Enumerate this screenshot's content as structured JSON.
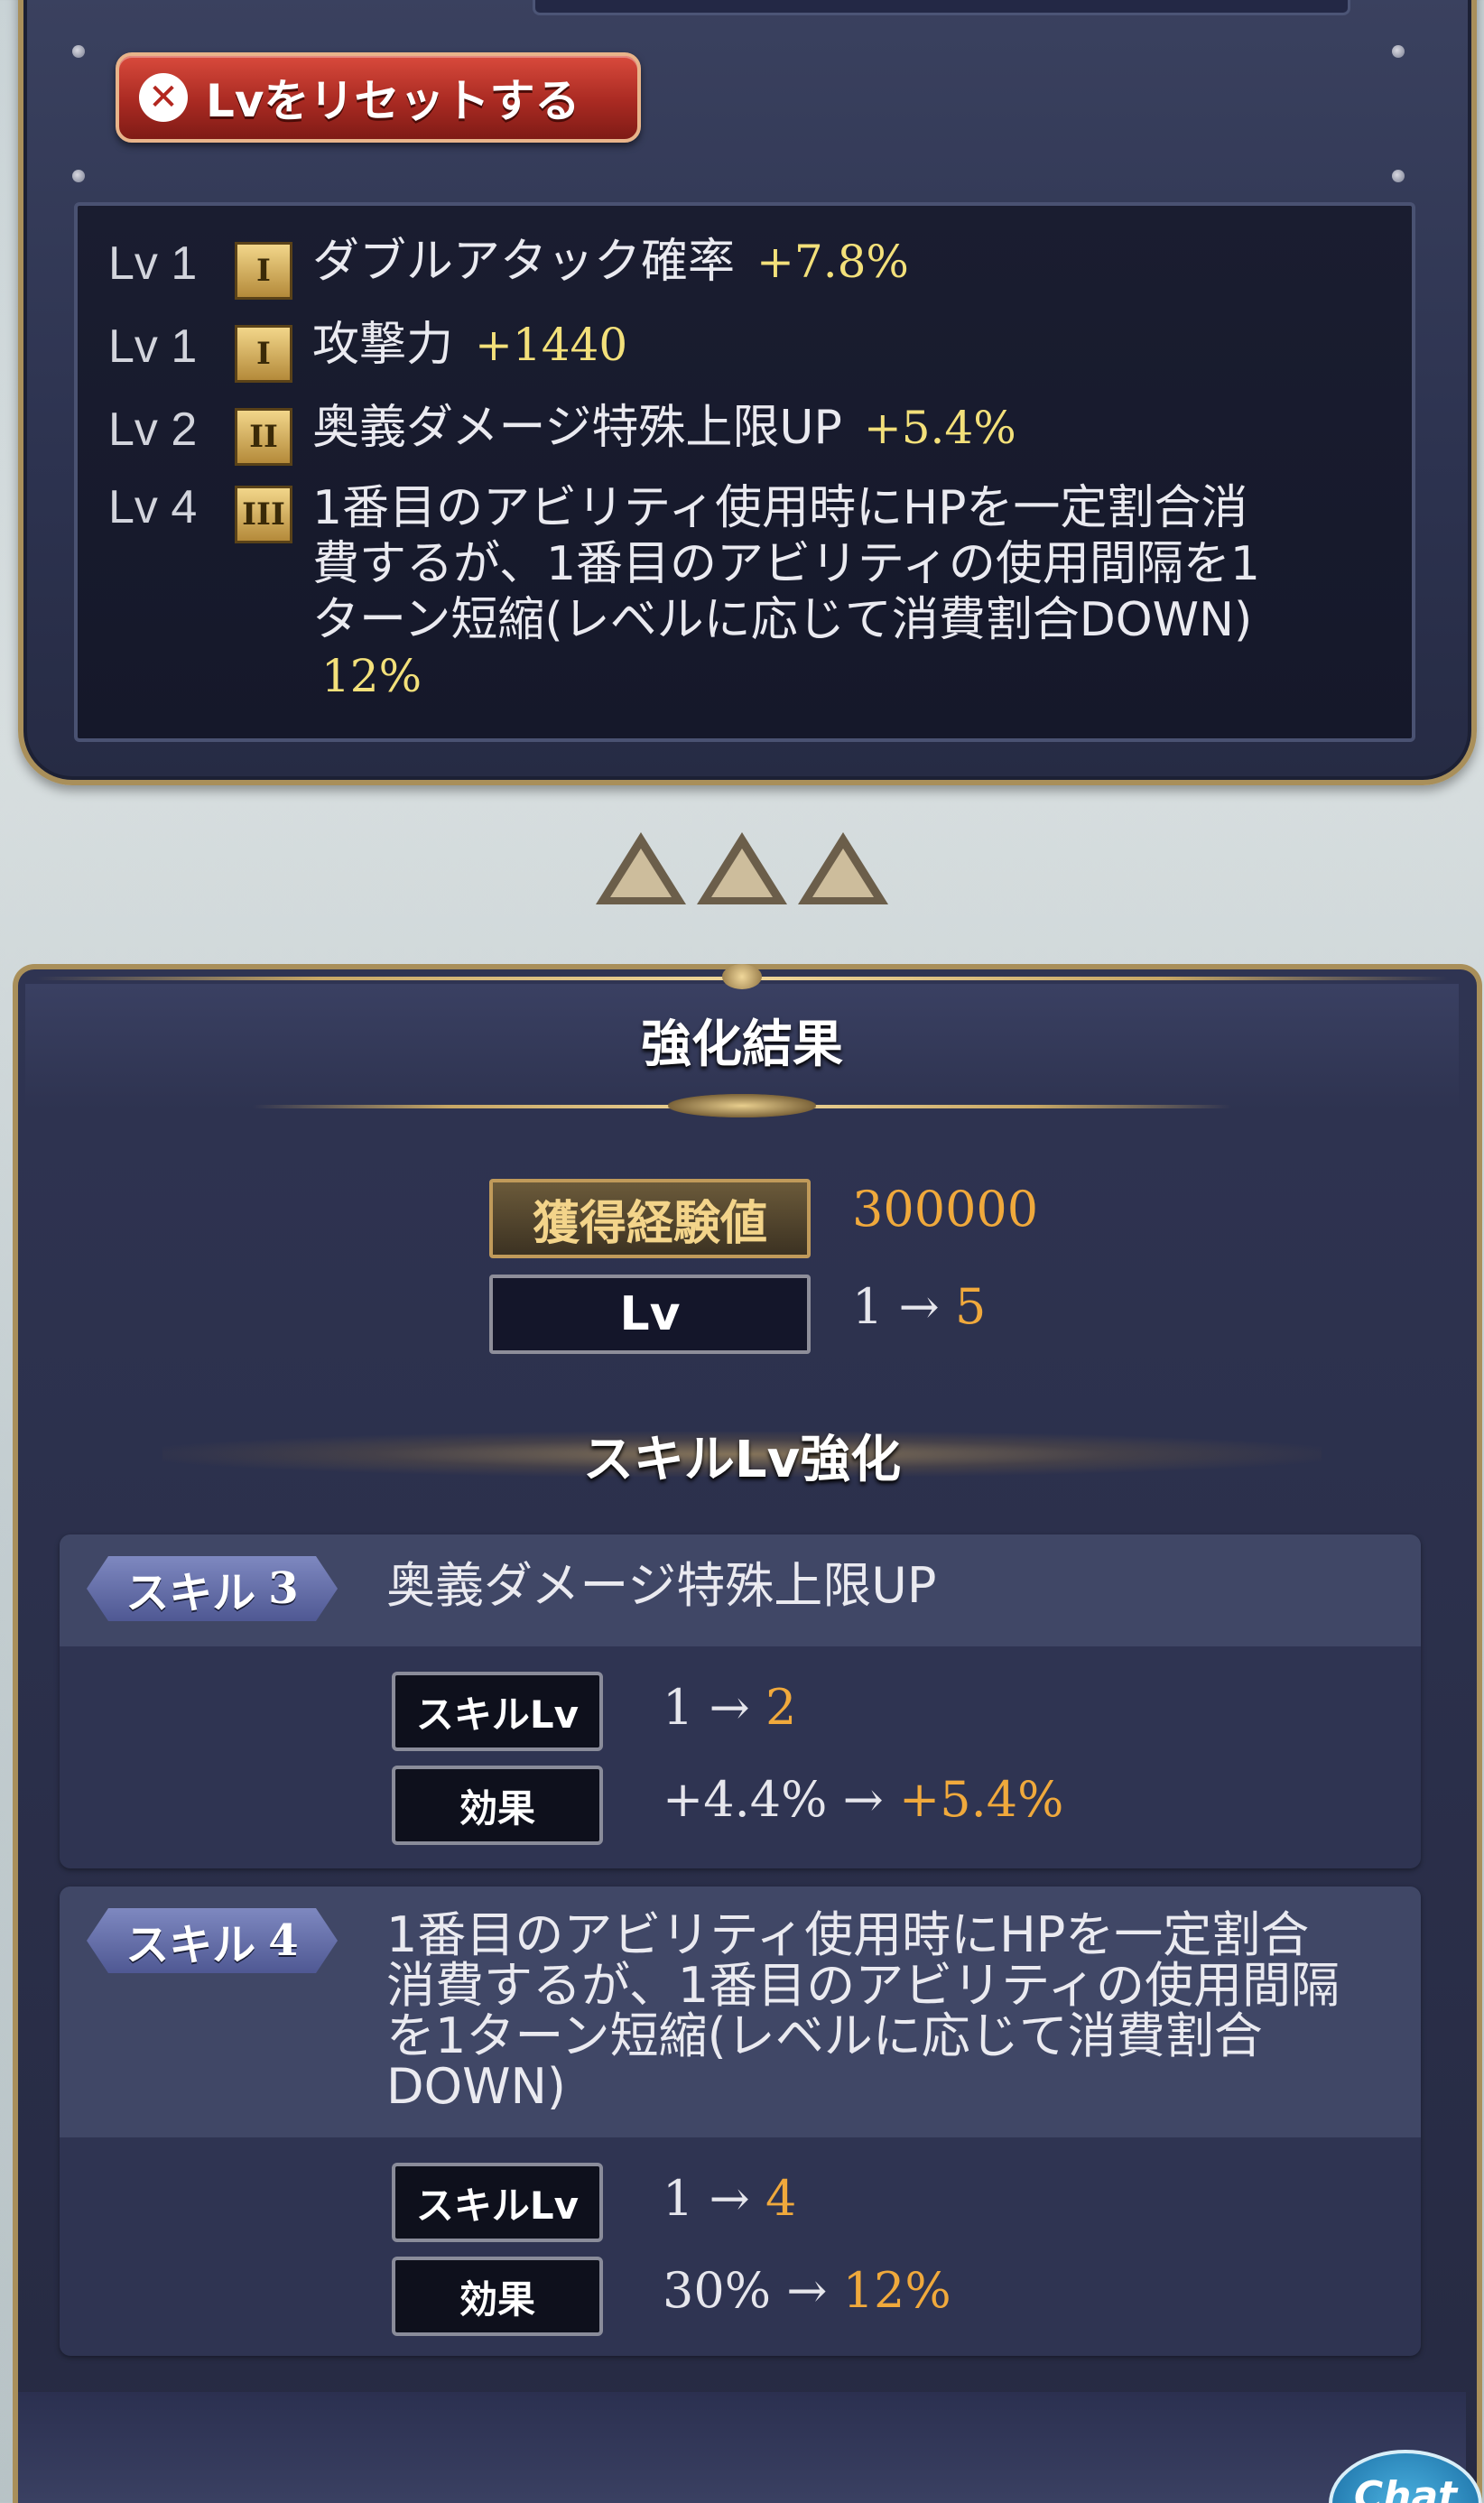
{
  "reset_button": {
    "label": "Lvをリセットする"
  },
  "lv_list": [
    {
      "level": "Lv 1",
      "rank": "I",
      "description": "ダブルアタック確率",
      "value": "+7.8%"
    },
    {
      "level": "Lv 1",
      "rank": "I",
      "description": "攻撃力",
      "value": "+1440"
    },
    {
      "level": "Lv 2",
      "rank": "II",
      "description": "奥義ダメージ特殊上限UP",
      "value": "+5.4%"
    },
    {
      "level": "Lv 4",
      "rank": "III",
      "description_lines": [
        "1番目のアビリティ使用時にHPを一定割合消",
        "費するが、1番目のアビリティの使用間隔を1",
        "ターン短縮(レベルに応じて消費割合DOWN)"
      ],
      "value": "12%"
    }
  ],
  "result": {
    "title": "強化結果",
    "exp_label": "獲得経験値",
    "exp_value": "300000",
    "lv_label": "Lv",
    "lv_from": "1 →",
    "lv_to": "5",
    "skill_section_title": "スキルLv強化"
  },
  "skills": [
    {
      "tab_label": "スキル",
      "tab_number": "3",
      "name_lines": [
        "奥義ダメージ特殊上限UP"
      ],
      "skill_lv_label": "スキルLv",
      "skill_lv_from": "1 →",
      "skill_lv_to": "2",
      "effect_label": "効果",
      "effect_from": "+4.4% →",
      "effect_to": "+5.4%"
    },
    {
      "tab_label": "スキル",
      "tab_number": "4",
      "name_lines": [
        "1番目のアビリティ使用時にHPを一定割合",
        "消費するが、1番目のアビリティの使用間隔",
        "を1ターン短縮(レベルに応じて消費割合",
        "DOWN)"
      ],
      "skill_lv_label": "スキルLv",
      "skill_lv_from": "1 →",
      "skill_lv_to": "4",
      "effect_label": "効果",
      "effect_from": "30% →",
      "effect_to": "12%"
    }
  ],
  "chat_button": {
    "label": "Chat"
  },
  "colors": {
    "gold_value": "#f3e07a",
    "orange_value": "#f0a93c",
    "frame_gold": "#a98f5a",
    "reset_red": "#a92a22"
  }
}
